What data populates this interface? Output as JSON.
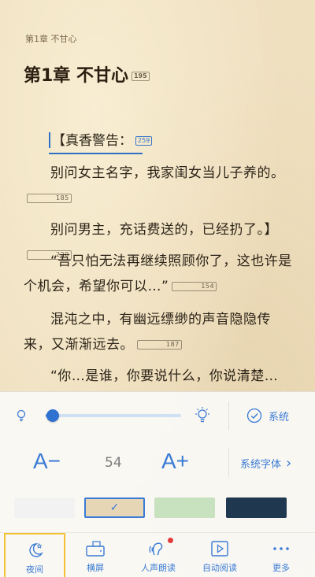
{
  "reader": {
    "running_title": "第1章 不甘心",
    "chapter_title": "第1章 不甘心",
    "chapter_badge": "195",
    "warning": "【真香警告：",
    "warning_badge": "259",
    "paragraphs": [
      {
        "text": "别问女主名字，我家闺女当儿子养的。",
        "badge": "185"
      },
      {
        "text": "别问男主，充话费送的，已经扔了。】",
        "badge": "220"
      },
      {
        "text": "“吾只怕无法再继续照顾你了，这也许是个机会，希望你可以…”",
        "badge": "154"
      },
      {
        "text": "混沌之中，有幽远缥缈的声音隐隐传来，又渐渐远去。",
        "badge": "187"
      },
      {
        "text": "“你…是谁，你要说什么，你说清楚…你…",
        "badge": ""
      }
    ]
  },
  "settings": {
    "brightness_fraction": 0.05,
    "system_label": "系统",
    "font_decrease_label": "A−",
    "font_size": "54",
    "font_increase_label": "A+",
    "system_font_label": "系统字体",
    "system_font_arrow": "›",
    "themes": [
      {
        "name": "white",
        "color": "#f2f2f2",
        "selected": false
      },
      {
        "name": "parchment",
        "color": "#e6d6b6",
        "selected": true
      },
      {
        "name": "green",
        "color": "#c8e2bf",
        "selected": false
      },
      {
        "name": "dark",
        "color": "#1f3850",
        "selected": false
      }
    ],
    "selected_check": "✓"
  },
  "tabs": [
    {
      "label": "夜间",
      "icon": "moon-icon",
      "active": true
    },
    {
      "label": "横屏",
      "icon": "landscape-icon",
      "active": false
    },
    {
      "label": "人声朗读",
      "icon": "voice-read-icon",
      "active": false
    },
    {
      "label": "自动阅读",
      "icon": "auto-read-icon",
      "active": false
    },
    {
      "label": "更多",
      "icon": "more-icon",
      "active": false
    }
  ],
  "colors": {
    "accent": "#3a7bd5",
    "active_tab_border": "#f1c232",
    "notification_dot": "#e23b3b"
  }
}
